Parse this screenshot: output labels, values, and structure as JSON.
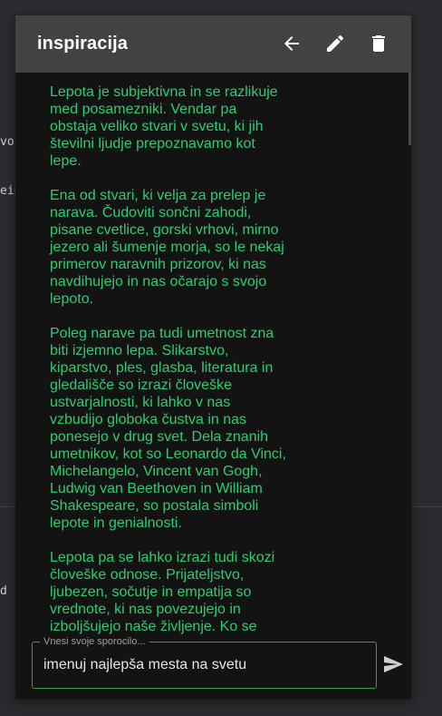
{
  "chat": {
    "title": "inspiracija",
    "icons": {
      "back": "arrow-left-icon",
      "edit": "pencil-icon",
      "delete": "trash-icon",
      "send": "send-icon"
    },
    "messages": [
      {
        "role": "assistant",
        "paragraphs": [
          "Lepota je subjektivna in se razlikuje med posamezniki. Vendar pa obstaja veliko stvari v svetu, ki jih številni ljudje prepoznavamo kot lepe.",
          "Ena od stvari, ki velja za prelep je narava. Čudoviti sončni zahodi, pisane cvetlice, gorski vrhovi, mirno jezero ali šumenje morja, so le nekaj primerov naravnih prizorov, ki nas navdihujejo in nas očarajo s svojo lepoto.",
          "Poleg narave pa tudi umetnost zna biti izjemno lepa. Slikarstvo, kiparstvo, ples, glasba, literatura in gledališče so izrazi človeške ustvarjalnosti, ki lahko v nas vzbudijo globoka čustva in nas ponesejo v drug svet. Dela znanih umetnikov, kot so Leonardo da Vinci, Michelangelo, Vincent van Gogh, Ludwig van Beethoven in William Shakespeare, so postala simboli lepote in genialnosti.",
          "Lepota pa se lahko izrazi tudi skozi človeške odnose. Prijateljstvo, ljubezen, sočutje in empatija so vrednote, ki nas povezujejo in izboljšujejo naše življenje. Ko se"
        ]
      }
    ],
    "composer": {
      "label": "Vnesi svoje sporocilo...",
      "value": "imenuj najlepša mesta na svetu"
    }
  },
  "background": {
    "code_lines": [
      "vo",
      "ein",
      "  \""
    ],
    "lower_text": "d"
  },
  "colors": {
    "accent": "#2ecc71",
    "header": "#424242",
    "panel": "#131313"
  }
}
